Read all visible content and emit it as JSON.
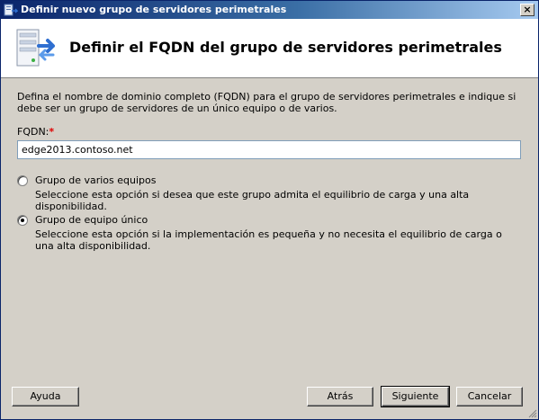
{
  "window": {
    "title": "Definir nuevo grupo de servidores perimetrales",
    "close_label": "×"
  },
  "header": {
    "title": "Definir el FQDN del grupo de servidores perimetrales"
  },
  "main": {
    "description": "Defina el nombre de dominio completo (FQDN) para el grupo de servidores perimetrales e indique si debe ser un grupo de servidores de un único equipo o de varios.",
    "fqdn_label": "FQDN:",
    "fqdn_required_mark": "*",
    "fqdn_value": "edge2013.contoso.net",
    "options": [
      {
        "label": "Grupo de varios equipos",
        "description": "Seleccione esta opción si desea que este grupo admita el equilibrio de carga y una alta disponibilidad.",
        "checked": false
      },
      {
        "label": "Grupo de equipo único",
        "description": "Seleccione esta opción si la implementación es pequeña y no necesita el equilibrio de carga o una alta disponibilidad.",
        "checked": true
      }
    ]
  },
  "buttons": {
    "help": "Ayuda",
    "back": "Atrás",
    "next": "Siguiente",
    "cancel": "Cancelar"
  },
  "colors": {
    "titlebar_start": "#0a246a",
    "titlebar_end": "#a6caf0",
    "dialog_bg": "#d4d0c8",
    "required": "#e00000"
  },
  "icons": {
    "title": "server-group-icon",
    "header": "server-arrow-icon"
  }
}
